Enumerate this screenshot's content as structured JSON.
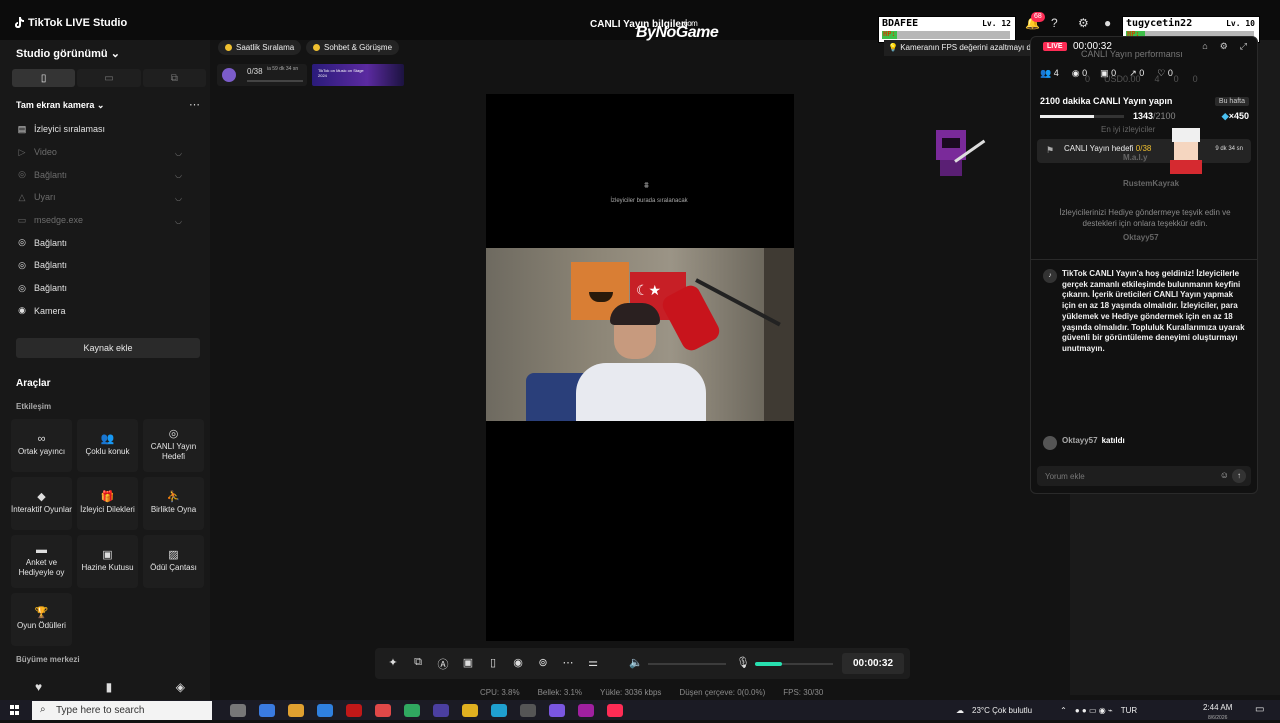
{
  "app": {
    "title": "TikTok LIVE Studio",
    "center_title": "CANLI Yayın bilgileri",
    "watermark": "ByNoGame",
    "watermark_suffix": ".com"
  },
  "sidebar": {
    "studio_view": "Studio görünümü",
    "scene_title": "Tam ekran kamera",
    "sources": [
      {
        "label": "İzleyici sıralaması",
        "icon": "ranking-icon",
        "dim": false
      },
      {
        "label": "Video",
        "icon": "play-icon",
        "dim": true
      },
      {
        "label": "Bağlantı",
        "icon": "globe-icon",
        "dim": true
      },
      {
        "label": "Uyarı",
        "icon": "alert-icon",
        "dim": true
      },
      {
        "label": "msedge.exe",
        "icon": "window-icon",
        "dim": true
      },
      {
        "label": "Bağlantı",
        "icon": "globe-icon",
        "dim": false
      },
      {
        "label": "Bağlantı",
        "icon": "globe-icon",
        "dim": false
      },
      {
        "label": "Bağlantı",
        "icon": "globe-icon",
        "dim": false
      },
      {
        "label": "Kamera",
        "icon": "camera-icon",
        "dim": false
      }
    ],
    "add_source": "Kaynak ekle",
    "tools_title": "Araçlar",
    "interaction_title": "Etkileşim",
    "tools": [
      {
        "label": "Ortak yayıncı",
        "icon": "link-icon"
      },
      {
        "label": "Çoklu konuk",
        "icon": "users-icon"
      },
      {
        "label": "CANLI Yayın Hedefi",
        "icon": "target-icon"
      },
      {
        "label": "İnteraktif Oyunlar",
        "icon": "gamepad-icon"
      },
      {
        "label": "İzleyici Dilekleri",
        "icon": "gift-icon"
      },
      {
        "label": "Birlikte Oyna",
        "icon": "play-together-icon"
      },
      {
        "label": "Anket ve Hediyeyle oy",
        "icon": "poll-icon"
      },
      {
        "label": "Hazine Kutusu",
        "icon": "treasure-icon"
      },
      {
        "label": "Ödül Çantası",
        "icon": "bag-icon"
      },
      {
        "label": "Oyun Ödülleri",
        "icon": "trophy-icon"
      }
    ],
    "growth_title": "Büyüme merkezi"
  },
  "top_chips": [
    {
      "label": "Saatlik Sıralama"
    },
    {
      "label": "Sohbet & Görüşme"
    }
  ],
  "goal_widget": {
    "value": "0/38",
    "time": "ia 59 dk 34 sn"
  },
  "banner": {
    "text": "TikTok on Music on Stage 2024"
  },
  "preview": {
    "placeholder": "İzleyiciler burada sıralanacak"
  },
  "controls": {
    "timer": "00:00:32",
    "mic_level": 0.35
  },
  "stats": {
    "cpu": "CPU: 3.8%",
    "memory": "Bellek: 3.1%",
    "upload": "Yükle: 3036 kbps",
    "dropped": "Düşen çerçeve: 0(0.0%)",
    "fps": "FPS: 30/30"
  },
  "overlays": {
    "card1": {
      "name": "BDAFEE",
      "level": "Lv. 12",
      "hp_label": "HP:",
      "hp": 0.12
    },
    "card2": {
      "name": "tugycetin22",
      "level": "Lv. 10",
      "hp_label": "HP:",
      "hp": 0.15
    },
    "fps_warning": "Kameranın FPS değerini azaltmayı dene"
  },
  "notifications": {
    "count": "68"
  },
  "live_panel": {
    "live_label": "LIVE",
    "timer": "00:00:32",
    "performance": "CANLI Yayın performansı",
    "stats": [
      {
        "icon": "viewers-icon",
        "value": "4"
      },
      {
        "icon": "eye-icon",
        "value": "0"
      },
      {
        "icon": "gift-icon",
        "value": "0"
      },
      {
        "icon": "share-icon",
        "value": "0"
      },
      {
        "icon": "heart-icon",
        "value": "0"
      }
    ],
    "ghost_stats": [
      "0",
      "USD0.00",
      "4",
      "0",
      "0"
    ],
    "goal_title": "2100 dakika CANLI Yayın yapın",
    "week": "Bu hafta",
    "progress_value": "1343",
    "progress_total": "/2100",
    "progress_ratio": 0.64,
    "reward": "×450",
    "top_viewers": "En iyi izleyiciler",
    "goal_card": {
      "label": "CANLI Yayın hedefi",
      "value": "0/38",
      "time": "9 dk 34 sn"
    },
    "ghost_names": [
      "RustemKayrak",
      "Oktayy57",
      "M.a.l.y"
    ],
    "invite": "İzleyicilerinizi Hediye göndermeye teşvik edin ve destekleri için onlara teşekkür edin.",
    "welcome": "TikTok CANLI Yayın'a hoş geldiniz! İzleyicilerle gerçek zamanlı etkileşimde bulunmanın keyfini çıkarın. İçerik üreticileri CANLI Yayın yapmak için en az 18 yaşında olmalıdır. İzleyiciler, para yüklemek ve Hediye göndermek için en az 18 yaşında olmalıdır. Topluluk Kurallarımıza uyarak güvenli bir görüntüleme deneyimi oluşturmayı unutmayın.",
    "joined_user": "Oktayy57",
    "joined_text": "katıldı",
    "comment_placeholder": "Yorum ekle"
  },
  "taskbar": {
    "search_placeholder": "Type here to search",
    "weather": "23°C  Çok bulutlu",
    "lang": "TUR",
    "time": "2:44 AM",
    "date": "8/6/2026"
  }
}
